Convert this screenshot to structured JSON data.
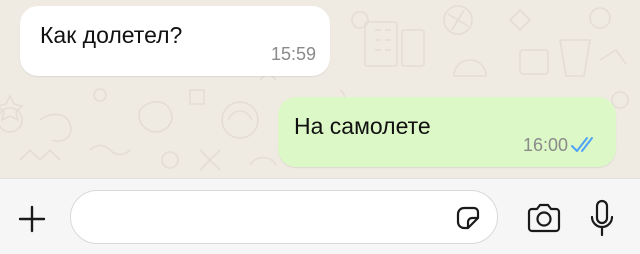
{
  "messages": [
    {
      "direction": "incoming",
      "text": "Как долетел?",
      "time": "15:59"
    },
    {
      "direction": "outgoing",
      "text": "На самолете",
      "time": "16:00",
      "status": "read",
      "tick_color": "#4fa3f7"
    }
  ],
  "input": {
    "placeholder": "",
    "value": ""
  },
  "icons": {
    "attach": "plus-icon",
    "sticker": "sticker-icon",
    "camera": "camera-icon",
    "mic": "microphone-icon"
  },
  "colors": {
    "background": "#efeae2",
    "incoming_bubble": "#ffffff",
    "outgoing_bubble": "#dcf8c6",
    "input_bar": "#f6f6f6"
  }
}
